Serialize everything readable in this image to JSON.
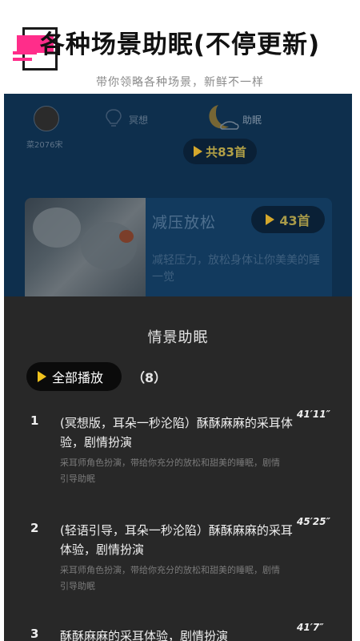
{
  "promo": {
    "title": "各种场景助眠(不停更新)",
    "subtitle": "带你领略各种场景，新鲜不一样"
  },
  "nav": {
    "avatar_label": "菜2076宋",
    "meditate_label": "冥想",
    "sleep_label": "助眠",
    "total_count": "共83首"
  },
  "card": {
    "title": "减压放松",
    "count": "43首",
    "description": "减轻压力，放松身体让你美美的睡一觉"
  },
  "sheet": {
    "title": "情景助眠",
    "play_all_label": "全部播放",
    "track_count": "（8）"
  },
  "tracks": [
    {
      "number": "1",
      "title": "(冥想版，耳朵一秒沦陷）酥酥麻麻的采耳体验，剧情扮演",
      "duration": "41′11″",
      "description": "采耳师角色扮演，带给你充分的放松和甜美的睡眠，剧情引导助眠"
    },
    {
      "number": "2",
      "title": "(轻语引导，耳朵一秒沦陷）酥酥麻麻的采耳体验，剧情扮演",
      "duration": "45′25″",
      "description": "采耳师角色扮演，带给你充分的放松和甜美的睡眠，剧情引导助眠"
    },
    {
      "number": "3",
      "title": "酥酥麻麻的采耳体验，剧情扮演",
      "duration": "41′7″",
      "description": ""
    }
  ],
  "colors": {
    "accent_pink": "#ff2d8a",
    "play_yellow": "#f0c21d",
    "screen_bg": "#0e2f4d",
    "sheet_bg": "#282828"
  }
}
